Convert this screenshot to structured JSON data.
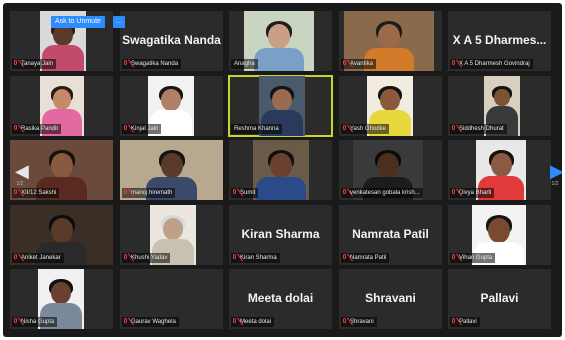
{
  "controls": {
    "ask_unmute": "Ask to Unmute",
    "more": "…"
  },
  "pager": {
    "left_page": "1/2",
    "right_page": "1/2"
  },
  "participants": [
    {
      "label": "Tanaya Jain",
      "big": "",
      "video": "video1",
      "muted": true
    },
    {
      "label": "Swagatika Nanda",
      "big": "Swagatika Nanda",
      "video": "",
      "muted": true
    },
    {
      "label": "Anagha",
      "big": "",
      "video": "video2",
      "muted": false
    },
    {
      "label": "Avantika",
      "big": "",
      "video": "video3",
      "muted": true
    },
    {
      "label": "X A 5 Dharmesh Govindraj",
      "big": "X A 5 Dharmes...",
      "video": "",
      "muted": true
    },
    {
      "label": "Rasika Pandit",
      "big": "",
      "video": "video4",
      "muted": true
    },
    {
      "label": "Kinjal Jain",
      "big": "",
      "video": "video5",
      "muted": true
    },
    {
      "label": "Reshma Khanna",
      "big": "",
      "video": "video6",
      "muted": false,
      "speaking": true
    },
    {
      "label": "Yash Ghodke",
      "big": "",
      "video": "video7",
      "muted": true
    },
    {
      "label": "Siddhesh Dhurat",
      "big": "",
      "video": "video8",
      "muted": true
    },
    {
      "label": "XII/12 Sakshi",
      "big": "",
      "video": "video9",
      "muted": true
    },
    {
      "label": "manoj hiremath",
      "big": "",
      "video": "video10",
      "muted": true
    },
    {
      "label": "Sumit",
      "big": "",
      "video": "video11",
      "muted": true
    },
    {
      "label": "venkatesan gobala krish...",
      "big": "",
      "video": "video12",
      "muted": true
    },
    {
      "label": "Divya Bharti",
      "big": "",
      "video": "video13",
      "muted": true
    },
    {
      "label": "Aniket Janekar",
      "big": "",
      "video": "video14",
      "muted": true
    },
    {
      "label": "Khushi Yadav",
      "big": "",
      "video": "video15",
      "muted": true
    },
    {
      "label": "Kiran Sharma",
      "big": "Kiran Sharma",
      "video": "",
      "muted": true
    },
    {
      "label": "Namrata Patil",
      "big": "Namrata Patil",
      "video": "",
      "muted": true
    },
    {
      "label": "Vihan Gupta",
      "big": "",
      "video": "video16",
      "muted": true
    },
    {
      "label": "Nisha Gupta",
      "big": "",
      "video": "video17",
      "muted": true
    },
    {
      "label": "Gaurav Waghela",
      "big": "",
      "video": "",
      "muted": true
    },
    {
      "label": "Meeta dolai",
      "big": "Meeta dolai",
      "video": "",
      "muted": true
    },
    {
      "label": "Shravani",
      "big": "Shravani",
      "video": "",
      "muted": true
    },
    {
      "label": "Pallavi",
      "big": "Pallavi",
      "video": "",
      "muted": true
    }
  ]
}
